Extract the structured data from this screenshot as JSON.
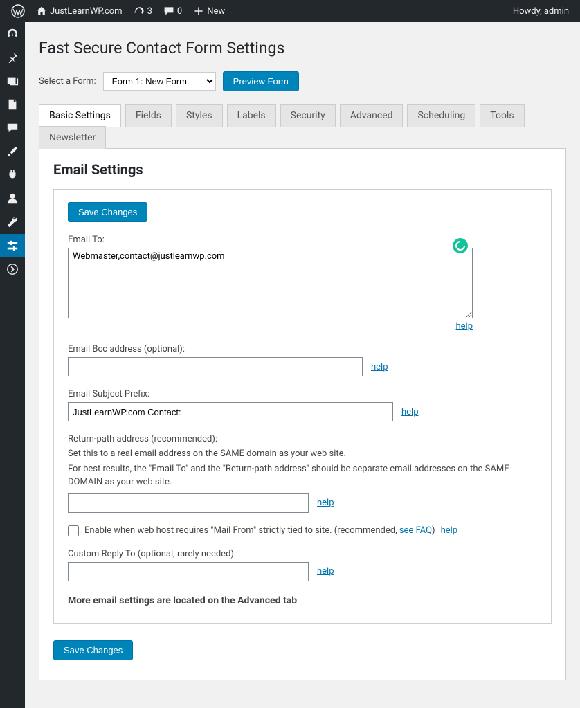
{
  "toolbar": {
    "site_name": "JustLearnWP.com",
    "updates_count": "3",
    "comments_count": "0",
    "new_label": "New",
    "howdy": "Howdy, admin"
  },
  "page": {
    "title": "Fast Secure Contact Form Settings",
    "select_form_label": "Select a Form:",
    "selected_form": "Form 1: New Form",
    "preview_button": "Preview Form"
  },
  "tabs": [
    "Basic Settings",
    "Fields",
    "Styles",
    "Labels",
    "Security",
    "Advanced",
    "Scheduling",
    "Tools",
    "Newsletter"
  ],
  "section": {
    "title": "Email Settings",
    "save_button": "Save Changes"
  },
  "fields": {
    "email_to": {
      "label": "Email To:",
      "value": "Webmaster,contact@justlearnwp.com"
    },
    "bcc": {
      "label": "Email Bcc address (optional):",
      "value": ""
    },
    "subject_prefix": {
      "label": "Email Subject Prefix:",
      "value": "JustLearnWP.com Contact:"
    },
    "return_path": {
      "label": "Return-path address (recommended):",
      "desc1": "Set this to a real email address on the SAME domain as your web site.",
      "desc2": "For best results, the \"Email To\" and the \"Return-path address\" should be separate email addresses on the SAME DOMAIN as your web site.",
      "value": ""
    },
    "mail_from_cb": {
      "label": "Enable when web host requires \"Mail From\" strictly tied to site. (recommended, ",
      "faq": "see FAQ",
      "close": ")"
    },
    "custom_reply": {
      "label": "Custom Reply To (optional, rarely needed):",
      "value": ""
    }
  },
  "help_text": "help",
  "note": "More email settings are located on the Advanced tab"
}
